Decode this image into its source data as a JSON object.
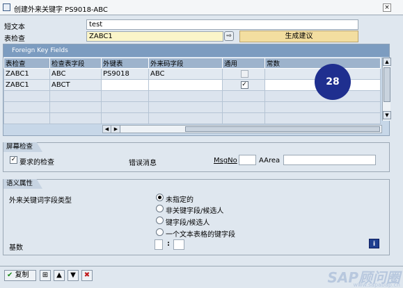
{
  "title": "创建外来关键字 PS9018-ABC",
  "fields": {
    "short_text_label": "短文本",
    "short_text_value": "test",
    "check_table_label": "表检查",
    "check_table_value": "ZABC1",
    "generate_button": "生成建议"
  },
  "fk_panel": {
    "title": "Foreign Key Fields",
    "columns": [
      "表检查",
      "检查表字段",
      "外键表",
      "外来码字段",
      "通用",
      "常数"
    ],
    "rows": [
      {
        "c1": "ZABC1",
        "c2": "ABC",
        "c3": "PS9018",
        "c4": "ABC",
        "generic": false,
        "generic_enabled": false,
        "c6": ""
      },
      {
        "c1": "ZABC1",
        "c2": "ABCT",
        "c3": "",
        "c4": "",
        "generic": true,
        "generic_enabled": true,
        "c6": ""
      }
    ],
    "badge": "28"
  },
  "screen_check": {
    "title": "屏幕检查",
    "required_label": "要求的检查",
    "required_checked": true,
    "error_msg_label": "错误消息",
    "msgno_label": "MsgNo",
    "msgno_value": "",
    "aarea_label": "AArea",
    "aarea_value": ""
  },
  "semantic": {
    "title": "语义属性",
    "field_type_label": "外来关键词字段类型",
    "options": [
      {
        "label": "未指定的",
        "selected": true
      },
      {
        "label": "非关键字段/候选人",
        "selected": false
      },
      {
        "label": "键字段/候选人",
        "selected": false
      },
      {
        "label": "一个文本表格的键字段",
        "selected": false
      }
    ],
    "cardinality_label": "基数",
    "cardinality_left": "",
    "cardinality_sep": ":",
    "cardinality_right": "",
    "info_icon_text": "i"
  },
  "footer": {
    "copy_label": "复制",
    "watermark": "SAP顾问圈",
    "watermark_url": "www.sapabap.cn"
  },
  "colors": {
    "panel_header": "#7c9cc0",
    "button_yellow": "#f3dea0",
    "badge": "#1f2f8f"
  }
}
